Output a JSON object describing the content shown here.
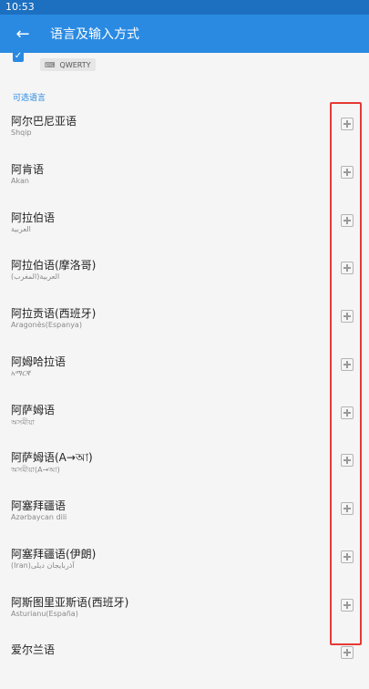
{
  "status_bar": {
    "time": "10:53"
  },
  "app_bar": {
    "title": "语言及输入方式"
  },
  "enabled_layout": {
    "checked": true,
    "chip_label": "QWERTY"
  },
  "section_header": "可选语言",
  "languages": [
    {
      "name": "阿尔巴尼亚语",
      "native": "Shqip"
    },
    {
      "name": "阿肯语",
      "native": "Akan"
    },
    {
      "name": "阿拉伯语",
      "native": "العربية"
    },
    {
      "name": "阿拉伯语(摩洛哥)",
      "native": "العربية(المغرب)"
    },
    {
      "name": "阿拉贡语(西班牙)",
      "native": "Aragonès(Espanya)"
    },
    {
      "name": "阿姆哈拉语",
      "native": "አማርኛ"
    },
    {
      "name": "阿萨姆语",
      "native": "অসমীয়া"
    },
    {
      "name": "阿萨姆语(A→আ)",
      "native": "অসমীয়া(A→আ)"
    },
    {
      "name": "阿塞拜疆语",
      "native": "Azərbaycan dili"
    },
    {
      "name": "阿塞拜疆语(伊朗)",
      "native": "(Iran)آذربایجان دیلی"
    },
    {
      "name": "阿斯图里亚斯语(西班牙)",
      "native": "Asturianu(España)"
    },
    {
      "name": "爱尔兰语",
      "native": ""
    }
  ],
  "colors": {
    "app_bar": "#2a8ae2",
    "status_bar": "#1d6fc0",
    "accent": "#2a8ae2",
    "highlight_box": "#e53935"
  },
  "icons": {
    "back": "arrow-left-icon",
    "keyboard": "keyboard-icon",
    "add": "add-box-icon"
  }
}
